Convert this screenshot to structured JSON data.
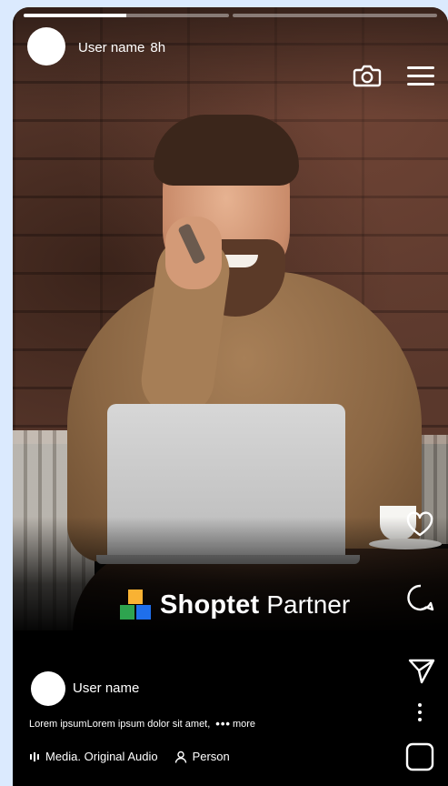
{
  "story": {
    "progress": [
      0.5,
      0
    ],
    "header": {
      "username": "User name",
      "time": "8h",
      "icons": [
        "camera-icon",
        "menu-icon"
      ]
    },
    "brand": {
      "name": "Shoptet",
      "suffix": "Partner",
      "logo_colors": [
        "#f9b233",
        "#2ea44f",
        "#1f6feb"
      ]
    },
    "actions": {
      "icons": [
        "heart-icon",
        "comment-icon",
        "send-icon",
        "more-icon",
        "square-icon"
      ]
    },
    "post": {
      "username": "User name",
      "caption": "Lorem ipsumLorem ipsum dolor sit amet,",
      "more_dots": "•••",
      "more_label": "more",
      "audio_label": "Media. Original Audio",
      "person_label": "Person"
    }
  }
}
